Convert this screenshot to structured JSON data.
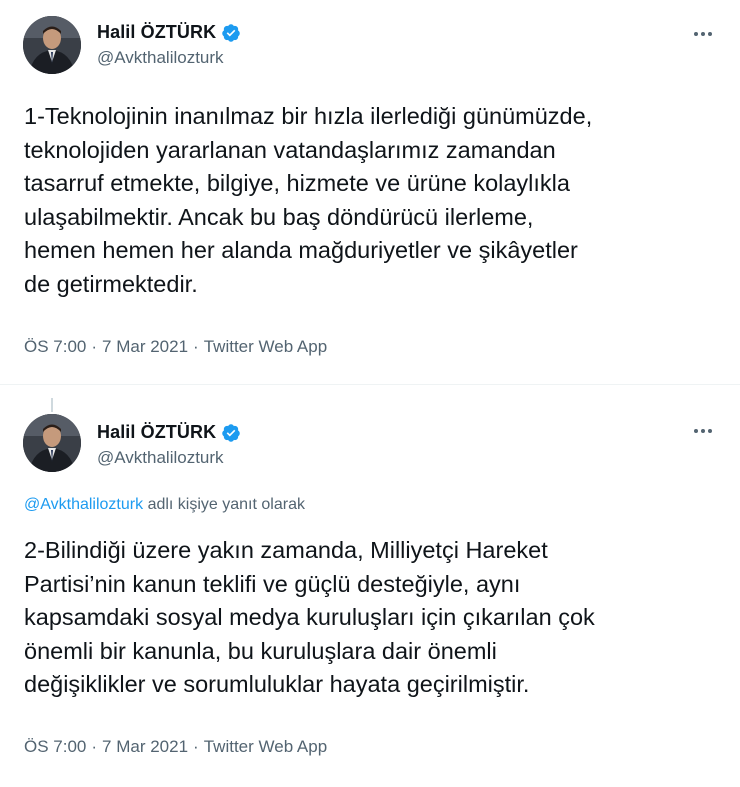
{
  "tweets": [
    {
      "author": {
        "display_name": "Halil ÖZTÜRK",
        "handle": "@Avkthalilozturk",
        "verified": true
      },
      "text": "1-Teknolojinin inanılmaz bir hızla ilerlediği günümüzde,\nteknolojiden yararlanan vatandaşlarımız zamandan\ntasarruf etmekte, bilgiye, hizmete ve ürüne kolaylıkla\nulaşabilmektir. Ancak bu baş döndürücü ilerleme,\nhemen hemen her alanda mağduriyetler ve şikâyetler\nde getirmektedir.",
      "time": "ÖS 7:00",
      "date": "7 Mar 2021",
      "source": "Twitter Web App",
      "separator": "·"
    },
    {
      "author": {
        "display_name": "Halil ÖZTÜRK",
        "handle": "@Avkthalilozturk",
        "verified": true
      },
      "reply_to_handle": "@Avkthalilozturk",
      "reply_suffix": "adlı kişiye yanıt olarak",
      "text": "2-Bilindiği üzere yakın zamanda, Milliyetçi Hareket\nPartisi’nin kanun teklifi ve güçlü desteğiyle, aynı\nkapsamdaki sosyal medya kuruluşları için çıkarılan çok\nönemli bir kanunla, bu kuruluşlara dair önemli\ndeğişiklikler ve sorumluluklar hayata geçirilmiştir.",
      "time": "ÖS 7:00",
      "date": "7 Mar 2021",
      "source": "Twitter Web App",
      "separator": "·"
    }
  ],
  "colors": {
    "text_primary": "#0f1419",
    "text_secondary": "#536471",
    "link": "#1d9bf0",
    "verified_badge": "#1d9bf0",
    "divider": "#eff3f4"
  },
  "icons": {
    "verified": "verified-badge-icon",
    "more": "more-horizontal-icon"
  }
}
